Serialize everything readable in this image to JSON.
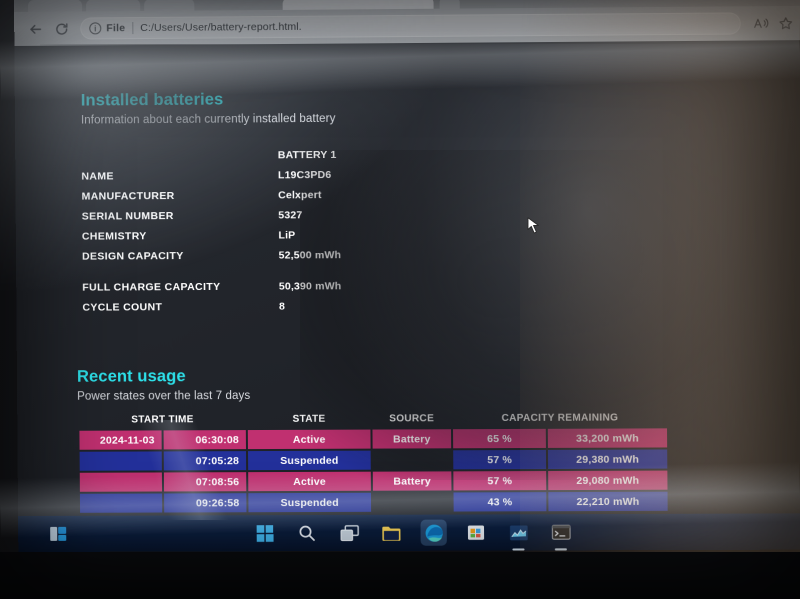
{
  "browser": {
    "name": "Microsoft Edge",
    "back_icon": "back-arrow-icon",
    "reload_icon": "reload-icon",
    "security_icon": "info-circle-icon",
    "security_label": "File",
    "url": "C:/Users/User/battery-report.html.",
    "read_aloud_icon": "read-aloud-icon",
    "favorite_icon": "star-icon"
  },
  "report": {
    "installed": {
      "heading": "Installed batteries",
      "subheading": "Information about each currently installed battery",
      "column_header": "BATTERY 1",
      "rows": [
        {
          "label": "NAME",
          "value": "L19C3PD6"
        },
        {
          "label": "MANUFACTURER",
          "value": "Celxpert"
        },
        {
          "label": "SERIAL NUMBER",
          "value": "5327"
        },
        {
          "label": "CHEMISTRY",
          "value": "LiP"
        },
        {
          "label": "DESIGN CAPACITY",
          "value": "52,500 mWh"
        }
      ],
      "rows2": [
        {
          "label": "FULL CHARGE CAPACITY",
          "value": "50,390 mWh"
        },
        {
          "label": "CYCLE COUNT",
          "value": "8"
        }
      ]
    },
    "recent_usage": {
      "heading": "Recent usage",
      "subheading": "Power states over the last 7 days",
      "columns": [
        "START TIME",
        "STATE",
        "SOURCE",
        "CAPACITY REMAINING"
      ],
      "rows": [
        {
          "date": "2024-11-03",
          "time": "06:30:08",
          "state": "Active",
          "source": "Battery",
          "percent": "65 %",
          "mwh": "33,200 mWh",
          "kind": "active"
        },
        {
          "date": "",
          "time": "07:05:28",
          "state": "Suspended",
          "source": "",
          "percent": "57 %",
          "mwh": "29,380 mWh",
          "kind": "susp"
        },
        {
          "date": "",
          "time": "07:08:56",
          "state": "Active",
          "source": "Battery",
          "percent": "57 %",
          "mwh": "29,080 mWh",
          "kind": "active"
        },
        {
          "date": "",
          "time": "09:26:58",
          "state": "Suspended",
          "source": "",
          "percent": "43 %",
          "mwh": "22,210 mWh",
          "kind": "susp"
        }
      ]
    }
  },
  "taskbar": {
    "items": [
      {
        "name": "start-button",
        "icon": "windows-logo-icon",
        "running": false,
        "selected": false
      },
      {
        "name": "search-button",
        "icon": "search-icon",
        "running": false,
        "selected": false
      },
      {
        "name": "task-view-button",
        "icon": "task-view-icon",
        "running": false,
        "selected": false
      },
      {
        "name": "file-explorer-button",
        "icon": "folder-icon",
        "running": false,
        "selected": false
      },
      {
        "name": "edge-button",
        "icon": "edge-icon",
        "running": true,
        "selected": true
      },
      {
        "name": "store-button",
        "icon": "store-icon",
        "running": false,
        "selected": false
      },
      {
        "name": "task-manager-button",
        "icon": "task-manager-icon",
        "running": true,
        "selected": false
      },
      {
        "name": "terminal-button",
        "icon": "terminal-icon",
        "running": true,
        "selected": false
      }
    ],
    "left_icon": "windows-widget-icon"
  },
  "colors": {
    "accent_cyan": "#2ddfe8",
    "row_active": "#c03070",
    "row_suspended": "#23309a",
    "page_bg": "#23262c"
  }
}
